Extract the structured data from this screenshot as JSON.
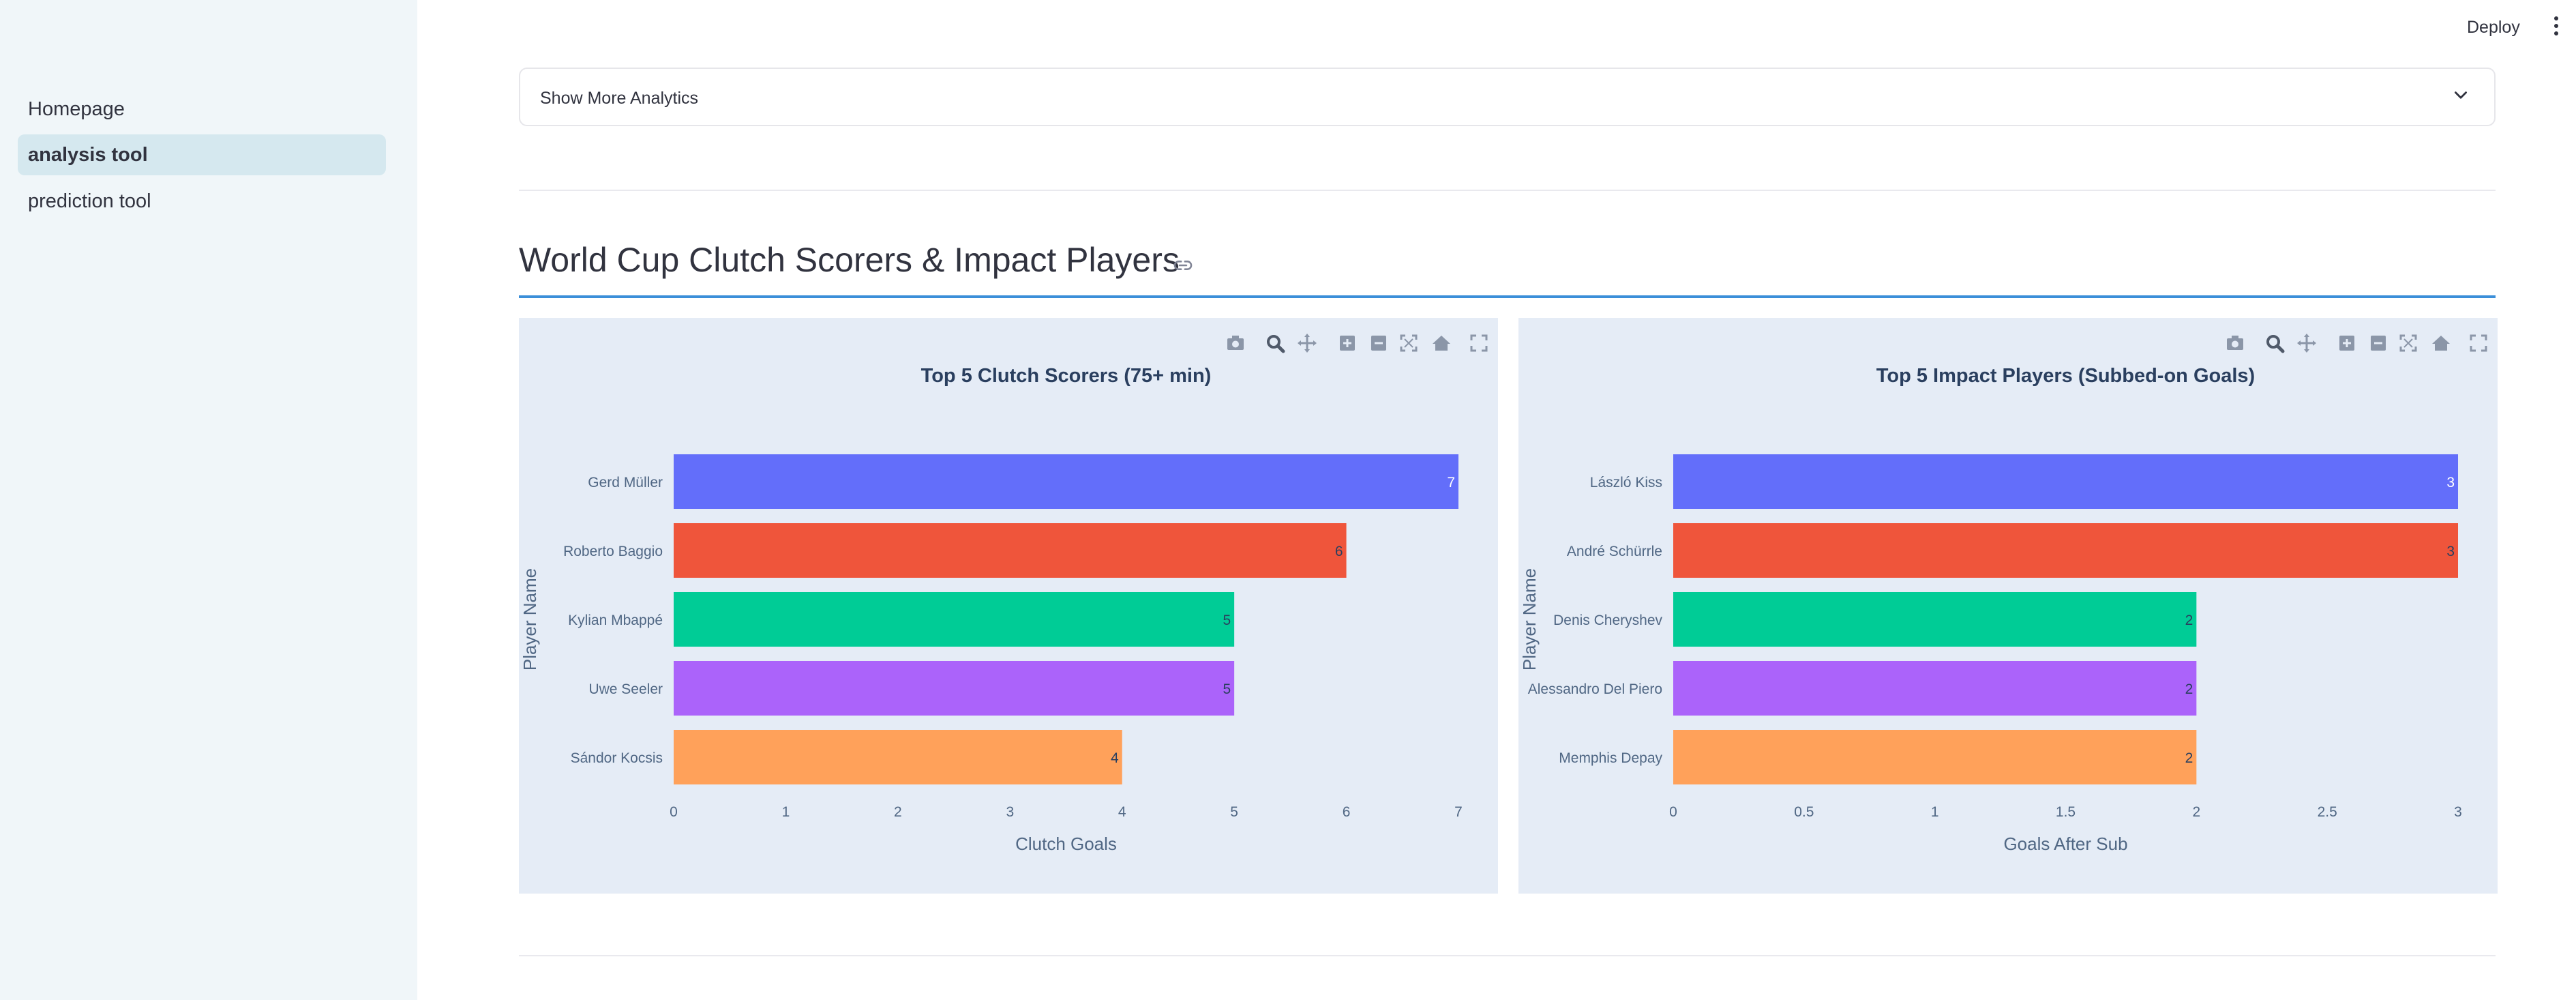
{
  "sidebar": {
    "items": [
      {
        "label": "Homepage",
        "active": false
      },
      {
        "label": "analysis tool",
        "active": true
      },
      {
        "label": "prediction tool",
        "active": false
      }
    ]
  },
  "header": {
    "deploy_label": "Deploy",
    "menu_icon": "kebab-menu-icon"
  },
  "expander": {
    "label": "Show More Analytics",
    "icon": "chevron-down-icon"
  },
  "section": {
    "title": "World Cup Clutch Scorers & Impact Players",
    "icon": "link-icon"
  },
  "toolbar_icons": [
    "camera-icon",
    "zoom-icon",
    "pan-icon",
    "zoom-in-icon",
    "zoom-out-icon",
    "autoscale-icon",
    "reset-axes-icon",
    "fullscreen-icon"
  ],
  "chart_data": [
    {
      "type": "bar",
      "orientation": "horizontal",
      "title": "Top 5 Clutch Scorers (75+ min)",
      "xlabel": "Clutch Goals",
      "ylabel": "Player Name",
      "categories": [
        "Gerd Müller",
        "Roberto Baggio",
        "Kylian Mbappé",
        "Uwe Seeler",
        "Sándor Kocsis"
      ],
      "values": [
        7,
        6,
        5,
        5,
        4
      ],
      "value_labels": [
        "7",
        "6",
        "5",
        "5",
        "4"
      ],
      "colors": [
        "#636efa",
        "#ef553b",
        "#00cc96",
        "#ab63fa",
        "#ffa15a"
      ],
      "xticks": [
        0,
        1,
        2,
        3,
        4,
        5,
        6,
        7
      ],
      "xtick_labels": [
        "0",
        "1",
        "2",
        "3",
        "4",
        "5",
        "6",
        "7"
      ],
      "xlim": [
        0,
        7
      ],
      "grid": false,
      "background": "#e5ecf6"
    },
    {
      "type": "bar",
      "orientation": "horizontal",
      "title": "Top 5 Impact Players (Subbed-on Goals)",
      "xlabel": "Goals After Sub",
      "ylabel": "Player Name",
      "categories": [
        "László Kiss",
        "André Schürrle",
        "Denis Cheryshev",
        "Alessandro Del Piero",
        "Memphis Depay"
      ],
      "values": [
        3,
        3,
        2,
        2,
        2
      ],
      "value_labels": [
        "3",
        "3",
        "2",
        "2",
        "2"
      ],
      "colors": [
        "#636efa",
        "#ef553b",
        "#00cc96",
        "#ab63fa",
        "#ffa15a"
      ],
      "xticks": [
        0,
        0.5,
        1,
        1.5,
        2,
        2.5,
        3
      ],
      "xtick_labels": [
        "0",
        "0.5",
        "1",
        "1.5",
        "2",
        "2.5",
        "3"
      ],
      "xlim": [
        0,
        3
      ],
      "grid": false,
      "background": "#e5ecf6"
    }
  ]
}
